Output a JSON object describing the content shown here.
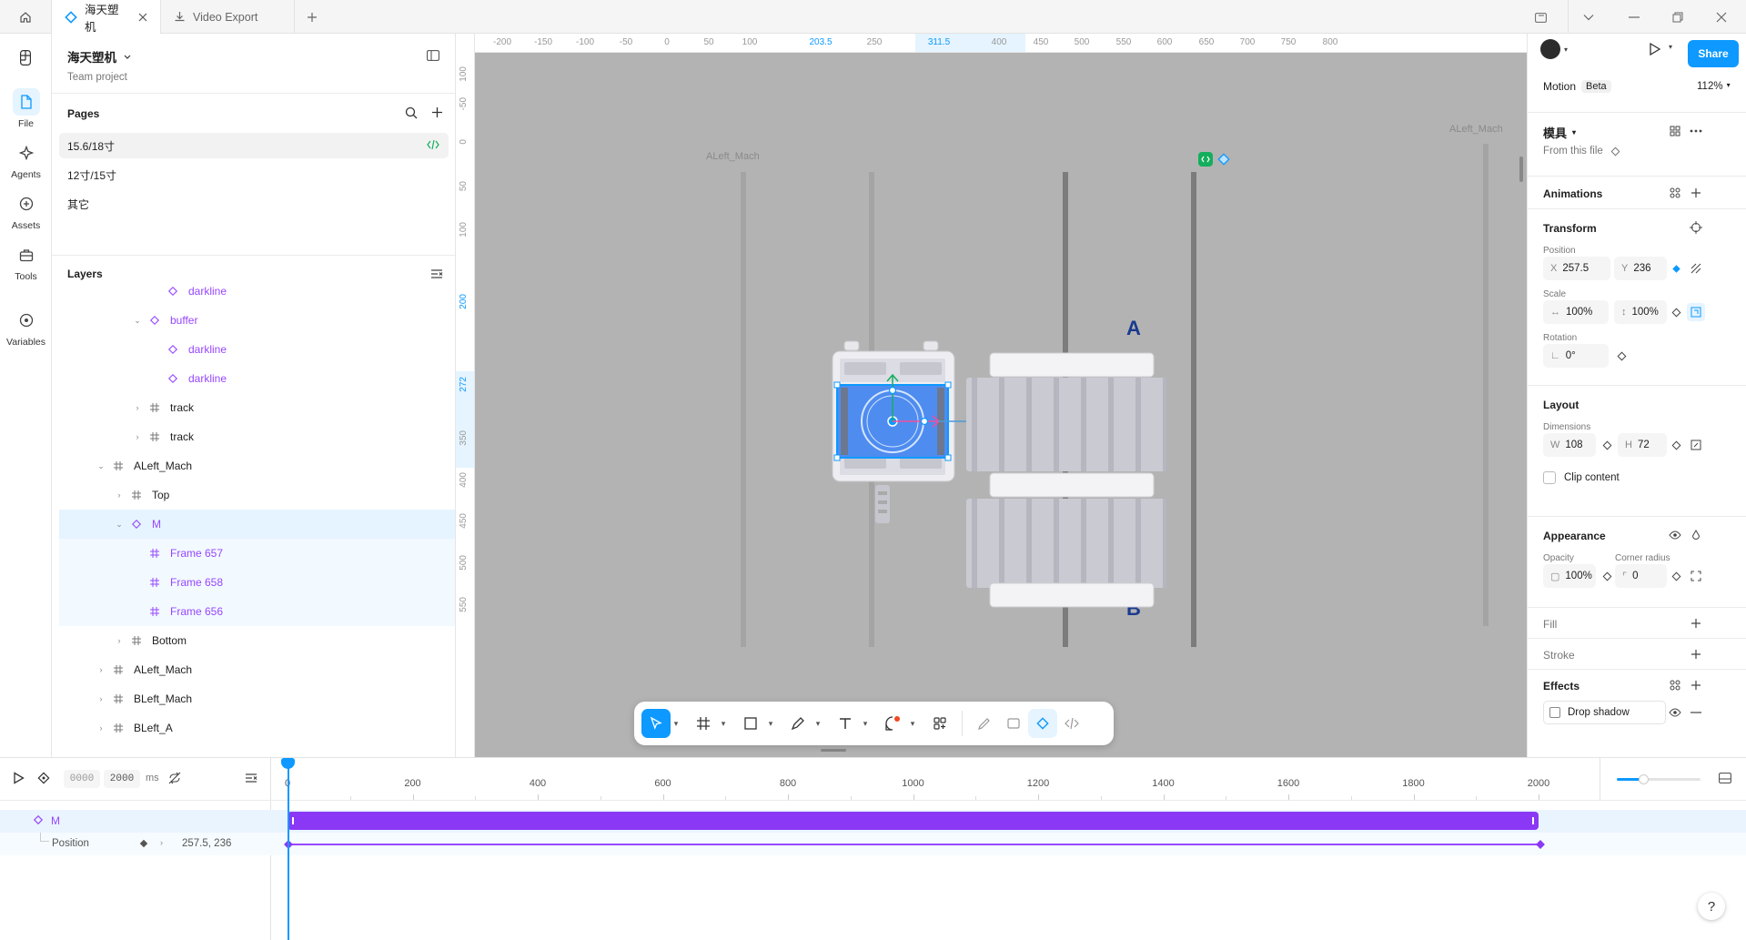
{
  "tabs": [
    {
      "label": "海天塑机",
      "active": true
    },
    {
      "label": "Video Export",
      "active": false
    }
  ],
  "rail": [
    {
      "label": "File",
      "icon": "file-icon"
    },
    {
      "label": "Agents",
      "icon": "agents-icon"
    },
    {
      "label": "Assets",
      "icon": "assets-icon"
    },
    {
      "label": "Tools",
      "icon": "tools-icon"
    },
    {
      "label": "Variables",
      "icon": "variables-icon"
    }
  ],
  "file": {
    "name": "海天塑机",
    "team": "Team project"
  },
  "pages": {
    "title": "Pages",
    "items": [
      {
        "label": "15.6/18寸",
        "selected": true
      },
      {
        "label": "12寸/15寸",
        "selected": false
      },
      {
        "label": "其它",
        "selected": false
      }
    ]
  },
  "layers": {
    "title": "Layers",
    "items": [
      {
        "label": "darkline",
        "type": "instance",
        "indent": 5,
        "expand": ""
      },
      {
        "label": "buffer",
        "type": "instance",
        "indent": 4,
        "expand": "v"
      },
      {
        "label": "darkline",
        "type": "instance",
        "indent": 5,
        "expand": ""
      },
      {
        "label": "darkline",
        "type": "instance",
        "indent": 5,
        "expand": ""
      },
      {
        "label": "track",
        "type": "frame",
        "indent": 4,
        "expand": ">"
      },
      {
        "label": "track",
        "type": "frame",
        "indent": 4,
        "expand": ">"
      },
      {
        "label": "ALeft_Mach",
        "type": "frame",
        "indent": 2,
        "expand": "v"
      },
      {
        "label": "Top",
        "type": "frame",
        "indent": 3,
        "expand": ">"
      },
      {
        "label": "M",
        "type": "instance",
        "indent": 3,
        "expand": "v",
        "selected": true
      },
      {
        "label": "Frame 657",
        "type": "frame-purple",
        "indent": 4,
        "expand": "",
        "highlight": true
      },
      {
        "label": "Frame 658",
        "type": "frame-purple",
        "indent": 4,
        "expand": "",
        "highlight": true
      },
      {
        "label": "Frame 656",
        "type": "frame-purple",
        "indent": 4,
        "expand": "",
        "highlight": true
      },
      {
        "label": "Bottom",
        "type": "frame",
        "indent": 3,
        "expand": ">"
      },
      {
        "label": "ALeft_Mach",
        "type": "frame",
        "indent": 2,
        "expand": ">"
      },
      {
        "label": "BLeft_Mach",
        "type": "frame",
        "indent": 2,
        "expand": ">"
      },
      {
        "label": "BLeft_A",
        "type": "frame",
        "indent": 2,
        "expand": ">"
      }
    ]
  },
  "ruler": {
    "top": [
      "-200",
      "-150",
      "-100",
      "-50",
      "0",
      "50",
      "100",
      "203.5",
      "250",
      "311.5",
      "400",
      "450",
      "500",
      "550",
      "600",
      "650",
      "700",
      "750",
      "800"
    ],
    "left": [
      "100",
      "-50",
      "0",
      "50",
      "100",
      "200",
      "272",
      "350",
      "400",
      "450",
      "500",
      "550"
    ]
  },
  "canvas": {
    "frame_label_left": "ALeft_Mach",
    "frame_label_right": "ALeft_Mach",
    "label_a": "A",
    "label_b": "B"
  },
  "right": {
    "mode": "Motion",
    "mode_badge": "Beta",
    "zoom": "112%",
    "share": "Share",
    "component": "模具",
    "from_file": "From this file",
    "animations": "Animations",
    "transform": "Transform",
    "position_label": "Position",
    "x_value": "257.5",
    "y_value": "236",
    "scale_label": "Scale",
    "scale_x": "100%",
    "scale_y": "100%",
    "rotation_label": "Rotation",
    "rotation": "0°",
    "layout": "Layout",
    "dimensions_label": "Dimensions",
    "w": "108",
    "h": "72",
    "clip_content": "Clip content",
    "appearance": "Appearance",
    "opacity_label": "Opacity",
    "opacity": "100%",
    "radius_label": "Corner radius",
    "radius": "0",
    "fill": "Fill",
    "stroke": "Stroke",
    "effects": "Effects",
    "drop_shadow": "Drop shadow"
  },
  "timeline": {
    "start": "0000",
    "end": "2000",
    "unit": "ms",
    "ticks": [
      "0",
      "200",
      "400",
      "600",
      "800",
      "1000",
      "1200",
      "1400",
      "1600",
      "1800",
      "2000"
    ],
    "track_name": "M",
    "property": "Position",
    "property_value": "257.5, 236"
  },
  "colors": {
    "accent": "#0d99ff",
    "purple": "#9747ff",
    "canvas": "#b3b3b3",
    "keyframe_bar": "#8a38f5"
  }
}
